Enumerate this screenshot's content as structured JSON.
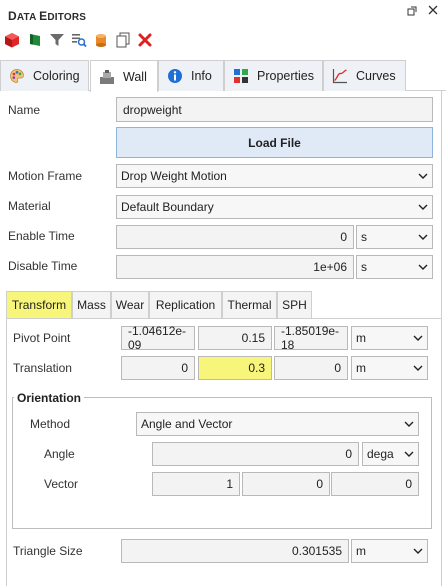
{
  "window": {
    "title_first": "D",
    "title_rest": "ATA ",
    "title_second": "E",
    "title_rest2": "DITORS",
    "title": "Data Editors",
    "pin_icon": "pin-icon",
    "close_icon": "close-icon"
  },
  "toolbar": {
    "icons": [
      "red-cube-icon",
      "green-flag-icon",
      "filter-icon",
      "search-list-icon",
      "cylinder-icon",
      "copy-icon",
      "delete-x-icon"
    ]
  },
  "tabs": [
    {
      "label": "Coloring",
      "icon": "palette-icon"
    },
    {
      "label": "Wall",
      "icon": "wall-icon",
      "active": true
    },
    {
      "label": "Info",
      "icon": "info-icon"
    },
    {
      "label": "Properties",
      "icon": "grid-icon"
    },
    {
      "label": "Curves",
      "icon": "curve-icon"
    }
  ],
  "form": {
    "name_label": "Name",
    "name_value": "dropweight",
    "load_file": "Load File",
    "motion_frame_label": "Motion Frame",
    "motion_frame_value": "Drop Weight Motion",
    "material_label": "Material",
    "material_value": "Default Boundary",
    "enable_time_label": "Enable Time",
    "enable_time_value": "0",
    "enable_time_unit": "s",
    "disable_time_label": "Disable Time",
    "disable_time_value": "1e+06",
    "disable_time_unit": "s"
  },
  "subtabs": [
    {
      "label": "Transform",
      "active": true
    },
    {
      "label": "Mass"
    },
    {
      "label": "Wear"
    },
    {
      "label": "Replication"
    },
    {
      "label": "Thermal"
    },
    {
      "label": "SPH"
    }
  ],
  "transform": {
    "pivot_label": "Pivot Point",
    "pivot_x": "-1.04612e-09",
    "pivot_y": "0.15",
    "pivot_z": "-1.85019e-18",
    "pivot_unit": "m",
    "translation_label": "Translation",
    "trans_x": "0",
    "trans_y": "0.3",
    "trans_z": "0",
    "trans_unit": "m",
    "orientation_title": "Orientation",
    "method_label": "Method",
    "method_value": "Angle and Vector",
    "angle_label": "Angle",
    "angle_value": "0",
    "angle_unit": "dega",
    "vector_label": "Vector",
    "vector_x": "1",
    "vector_y": "0",
    "vector_z": "0",
    "triangle_label": "Triangle Size",
    "triangle_value": "0.301535",
    "triangle_unit": "m"
  },
  "colors": {
    "highlight": "#f8f67a",
    "button_bg": "#dfeaf6",
    "delete_red": "#e02020"
  }
}
